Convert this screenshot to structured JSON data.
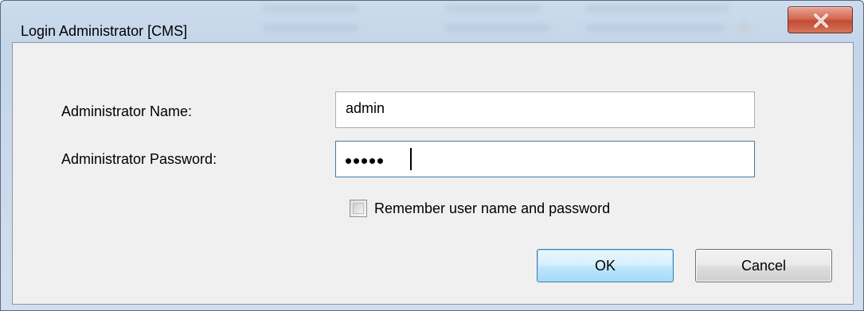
{
  "window": {
    "title": "Login Administrator [CMS]"
  },
  "form": {
    "name_label": "Administrator Name:",
    "name_value": "admin",
    "password_label": "Administrator Password:",
    "password_masked_length": 5,
    "remember_label": "Remember user name and password",
    "remember_checked": false
  },
  "buttons": {
    "ok_label": "OK",
    "cancel_label": "Cancel"
  },
  "icons": {
    "close": "close-icon"
  },
  "colors": {
    "close_button": "#c44b33",
    "ok_button_border": "#3c7fb1",
    "focus_border": "#3d7bad"
  }
}
